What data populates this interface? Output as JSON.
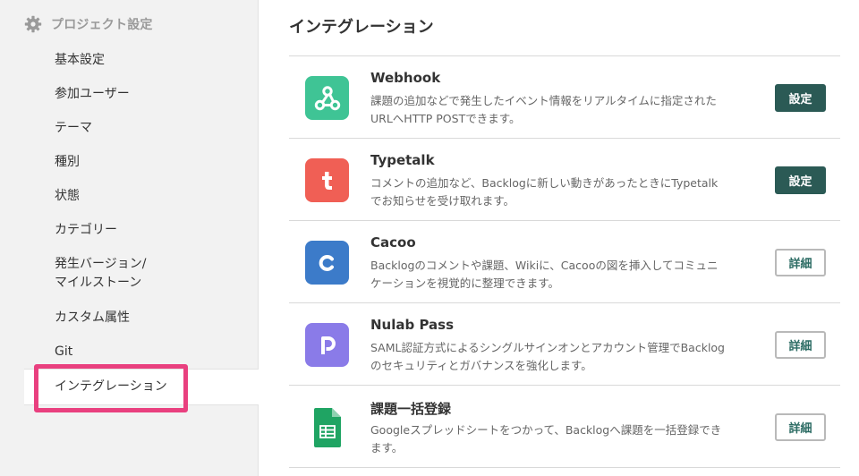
{
  "sidebar": {
    "title": "プロジェクト設定",
    "icon": "gear-icon",
    "items": [
      {
        "label": "基本設定"
      },
      {
        "label": "参加ユーザー"
      },
      {
        "label": "テーマ"
      },
      {
        "label": "種別"
      },
      {
        "label": "状態"
      },
      {
        "label": "カテゴリー"
      },
      {
        "label_line1": "発生バージョン/",
        "label_line2": "マイルストーン"
      },
      {
        "label": "カスタム属性"
      },
      {
        "label": "Git"
      },
      {
        "label": "インテグレーション",
        "active": true
      }
    ]
  },
  "main": {
    "title": "インテグレーション",
    "integrations": [
      {
        "name": "Webhook",
        "desc_line1": "課題の追加などで発生したイベント情報をリアルタイムに指定された",
        "desc_line2": "URLへHTTP POSTできます。",
        "button": "設定",
        "button_style": "primary",
        "icon": "webhook-icon",
        "color": "#3fc495"
      },
      {
        "name": "Typetalk",
        "desc_line1": "コメントの追加など、Backlogに新しい動きがあったときにTypetalk",
        "desc_line2": "でお知らせを受け取れます。",
        "button": "設定",
        "button_style": "primary",
        "icon": "typetalk-icon",
        "color": "#f05f55"
      },
      {
        "name": "Cacoo",
        "desc_line1": "Backlogのコメントや課題、Wikiに、Cacooの図を挿入してコミュニ",
        "desc_line2": "ケーションを視覚的に整理できます。",
        "button": "詳細",
        "button_style": "secondary",
        "icon": "cacoo-icon",
        "color": "#3c7bc9"
      },
      {
        "name": "Nulab Pass",
        "desc_line1": "SAML認証方式によるシングルサインオンとアカウント管理でBacklog",
        "desc_line2": "のセキュリティとガバナンスを強化します。",
        "button": "詳細",
        "button_style": "secondary",
        "icon": "nulab-pass-icon",
        "color": "#8a7be8"
      },
      {
        "name": "課題一括登録",
        "desc_line1": "Googleスプレッドシートをつかって、Backlogへ課題を一括登録でき",
        "desc_line2": "ます。",
        "button": "詳細",
        "button_style": "secondary",
        "icon": "google-sheets-icon",
        "color": "#1fa463"
      }
    ]
  },
  "colors": {
    "accent": "#2b5a55",
    "highlight": "#e9407f",
    "sidebar_bg": "#f2f2f2"
  }
}
